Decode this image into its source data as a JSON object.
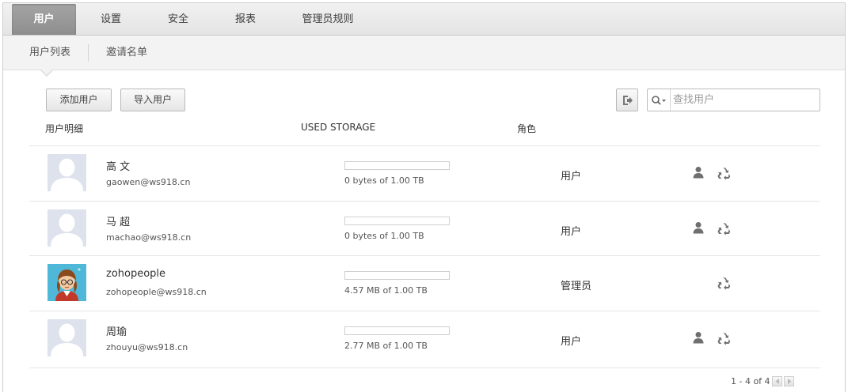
{
  "tabs": [
    {
      "label": "用户"
    },
    {
      "label": "设置"
    },
    {
      "label": "安全"
    },
    {
      "label": "报表"
    },
    {
      "label": "管理员规则"
    }
  ],
  "subtabs": [
    {
      "label": "用户列表"
    },
    {
      "label": "邀请名单"
    }
  ],
  "toolbar": {
    "add_user_label": "添加用户",
    "import_user_label": "导入用户",
    "search_placeholder": "查找用户",
    "search_value": ""
  },
  "table": {
    "headers": {
      "user": "用户明细",
      "storage": "USED STORAGE",
      "role": "角色"
    },
    "rows": [
      {
        "name": "高 文",
        "email": "gaowen@ws918.cn",
        "usage": "0 bytes of 1.00 TB",
        "fill": 0.0,
        "role": "用户",
        "avatar": "default-avatar",
        "actions": [
          "user-icon",
          "recycle-icon"
        ]
      },
      {
        "name": "马 超",
        "email": "machao@ws918.cn",
        "usage": "0 bytes of 1.00 TB",
        "fill": 0.0,
        "role": "用户",
        "avatar": "default-avatar",
        "actions": [
          "user-icon",
          "recycle-icon"
        ]
      },
      {
        "name": "zohopeople",
        "email": "zohopeople@ws918.cn",
        "usage": "4.57 MB of 1.00 TB",
        "fill": 0.0,
        "role": "管理员",
        "avatar": "cartoon-avatar",
        "actions": [
          "recycle-icon"
        ]
      },
      {
        "name": "周瑜",
        "email": "zhouyu@ws918.cn",
        "usage": "2.77 MB of 1.00 TB",
        "fill": 0.0,
        "role": "用户",
        "avatar": "default-avatar",
        "actions": [
          "user-icon",
          "recycle-icon"
        ]
      }
    ]
  },
  "pagination": {
    "text": "1 - 4 of 4"
  },
  "colors": {
    "active_tab": "#999999",
    "bar_fill": "#7ea9d8",
    "avatar_bg": "#dde2ec",
    "cartoon_bg": "#4fb8d8"
  }
}
